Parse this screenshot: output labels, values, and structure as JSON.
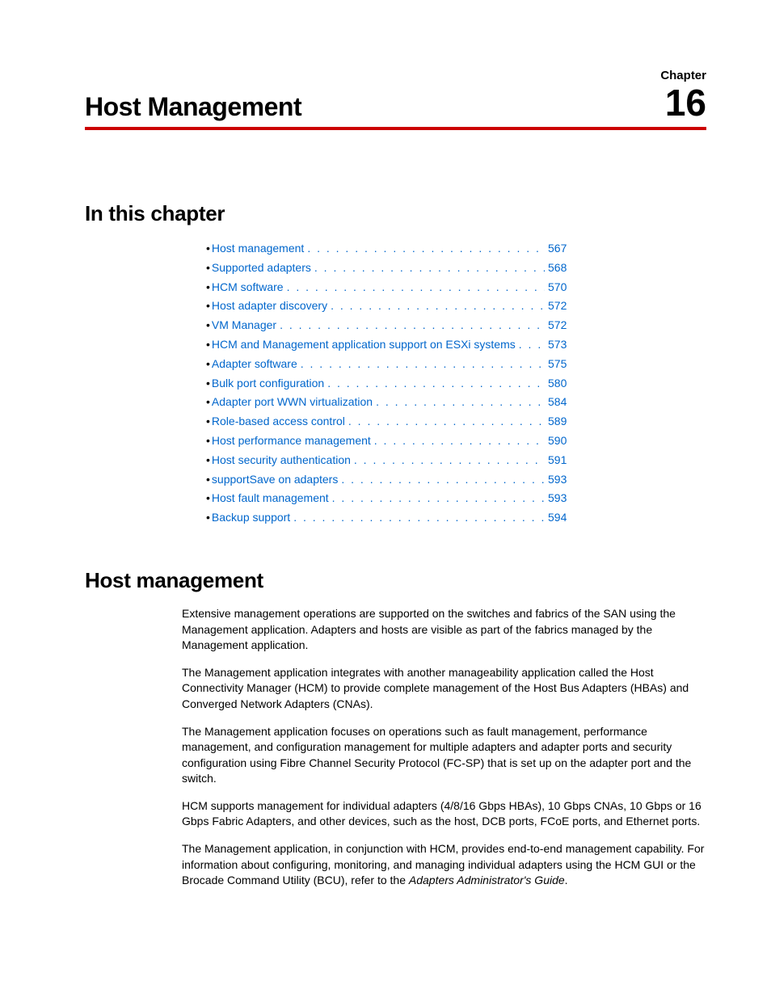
{
  "header": {
    "chapter_label": "Chapter",
    "title": "Host Management",
    "number": "16"
  },
  "toc": {
    "heading": "In this chapter",
    "items": [
      {
        "label": "Host management",
        "page": "567"
      },
      {
        "label": "Supported adapters",
        "page": "568"
      },
      {
        "label": "HCM software",
        "page": "570"
      },
      {
        "label": "Host adapter discovery",
        "page": "572"
      },
      {
        "label": "VM Manager",
        "page": "572"
      },
      {
        "label": "HCM and Management application support on ESXi systems",
        "page": "573"
      },
      {
        "label": "Adapter software",
        "page": "575"
      },
      {
        "label": "Bulk port configuration",
        "page": "580"
      },
      {
        "label": "Adapter port WWN virtualization",
        "page": "584"
      },
      {
        "label": "Role-based access control",
        "page": "589"
      },
      {
        "label": "Host performance management",
        "page": "590"
      },
      {
        "label": "Host security authentication",
        "page": "591"
      },
      {
        "label": "supportSave on adapters",
        "page": "593"
      },
      {
        "label": "Host fault management",
        "page": "593"
      },
      {
        "label": "Backup support",
        "page": "594"
      }
    ]
  },
  "section": {
    "heading": "Host management",
    "paragraphs": [
      "Extensive management operations are supported on the switches and fabrics of the SAN using the Management application. Adapters and hosts are visible as part of the fabrics managed by the Management application.",
      "The Management application integrates with another manageability application called the Host Connectivity Manager (HCM) to provide complete management of the Host Bus Adapters (HBAs) and Converged Network Adapters (CNAs).",
      "The Management application focuses on operations such as fault management, performance management, and configuration management for multiple adapters and adapter ports and security configuration using Fibre Channel Security Protocol (FC-SP) that is set up on the adapter port and the switch.",
      "HCM supports management for individual adapters (4/8/16 Gbps HBAs), 10 Gbps CNAs, 10 Gbps or 16 Gbps Fabric Adapters, and other devices, such as the host, DCB ports, FCoE ports, and Ethernet ports."
    ],
    "final_paragraph": {
      "pre": "The Management application, in conjunction with HCM, provides end-to-end management capability. For information about configuring, monitoring, and managing individual adapters using the HCM GUI or the Brocade Command Utility (BCU), refer to the ",
      "em": "Adapters Administrator's Guide",
      "post": "."
    }
  }
}
